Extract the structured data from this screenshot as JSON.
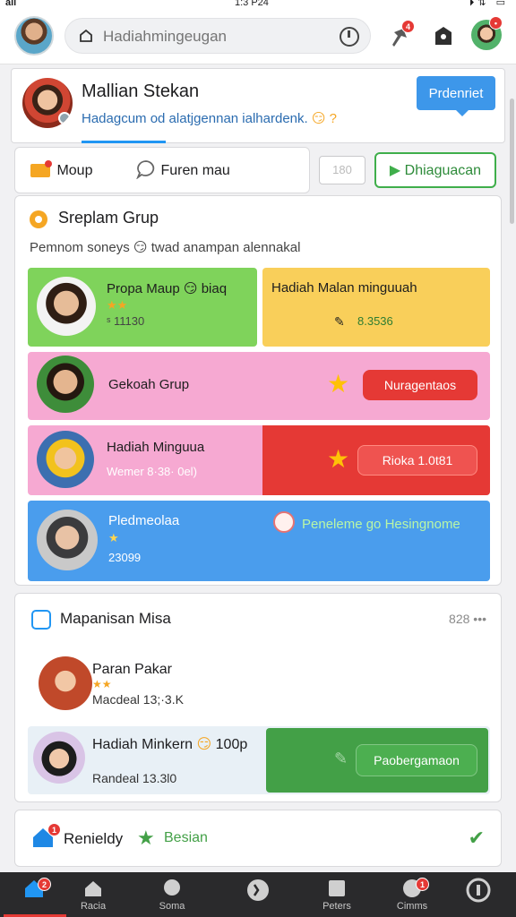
{
  "status_bar": {
    "left": "aıı",
    "time": "1:3 P24",
    "right": "⏵⇅ ▭"
  },
  "header": {
    "search_placeholder": "Hadiahmingeugan",
    "notif_badge": "4"
  },
  "profile": {
    "name": "Mallian Stekan",
    "status": "Hadagcum od alatjgennan ialhardenk.",
    "emoji": "😏 ?",
    "premium_label": "Prdenriet"
  },
  "actions": {
    "item1": "Moup",
    "item2": "Furen mau",
    "mini": "180",
    "green": "Dhiaguacan"
  },
  "groups": {
    "title": "Sreplam Grup",
    "subtitle": "Pemnom soneys 😏 twad anampan alennakal",
    "tiles": [
      {
        "name": "Propa Maup 😏 biaq",
        "meta": "ˢ 11130",
        "color": "#7fd35b"
      },
      {
        "name": "Hadiah Malan minguuah",
        "meta": "8.3536",
        "color": "#f9cf5a"
      },
      {
        "name": "Gekoah Grup",
        "button": "Nuragentaos",
        "color": "#f6a9d2"
      },
      {
        "name": "Hadiah Minguua",
        "meta": "Wemer 8·38· 0el)",
        "button": "Rioka 1.0t81",
        "color": "#f6a9d2"
      },
      {
        "name": "Pledmeolaa",
        "meta": "23099",
        "green_text": "Peneleme go Hesingnome",
        "color": "#4a9ded"
      }
    ]
  },
  "misa": {
    "title": "Mapanisan Misa",
    "count": "828 •••",
    "items": [
      {
        "name": "Paran Pakar",
        "meta": "Macdeal 13;·3.K"
      },
      {
        "name": "Hadiah Minkern",
        "score": "100p",
        "meta": "Randeal 13.3l0",
        "button": "Paobergamaon"
      }
    ]
  },
  "bottom": {
    "label": "Renieldy",
    "green_label": "Besian"
  },
  "nav": [
    {
      "label": "",
      "badge": "2"
    },
    {
      "label": "Racia"
    },
    {
      "label": "Soma"
    },
    {
      "label": ""
    },
    {
      "label": "Peters"
    },
    {
      "label": "Cimms",
      "badge": "1"
    },
    {
      "label": ""
    }
  ],
  "colors": {
    "accent": "#3d97ea",
    "green": "#3fae4b",
    "red": "#e53935"
  }
}
